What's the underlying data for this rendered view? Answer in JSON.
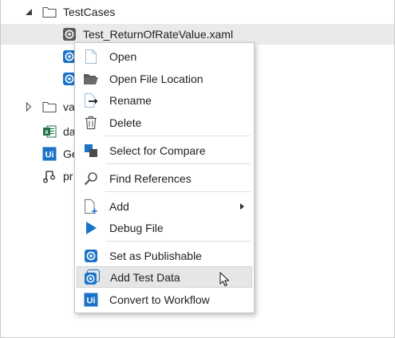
{
  "tree": {
    "rows": [
      {
        "label": "TestCases",
        "expander": "expanded",
        "icon": "folder-icon"
      },
      {
        "label": "Test_ReturnOfRateValue.xaml",
        "icon": "test-case-icon"
      },
      {
        "label": "",
        "icon": "test-case-icon"
      },
      {
        "label": "",
        "icon": "test-case-icon"
      },
      {
        "label": "va",
        "expander": "collapsed",
        "icon": "folder-icon"
      },
      {
        "label": "da",
        "icon": "excel-icon"
      },
      {
        "label": "Ge",
        "icon": "uipath-icon"
      },
      {
        "label": "pr",
        "icon": "project-icon"
      }
    ]
  },
  "context_menu": {
    "items": [
      {
        "label": "Open",
        "icon": "file-icon"
      },
      {
        "label": "Open File Location",
        "icon": "folder-open-icon"
      },
      {
        "label": "Rename",
        "icon": "rename-icon"
      },
      {
        "label": "Delete",
        "icon": "trash-icon"
      },
      {
        "label": "Select for Compare",
        "icon": "compare-icon"
      },
      {
        "label": "Find References",
        "icon": "search-icon"
      },
      {
        "label": "Add",
        "icon": "add-file-icon",
        "submenu": true
      },
      {
        "label": "Debug File",
        "icon": "play-icon"
      },
      {
        "label": "Set as Publishable",
        "icon": "publishable-icon"
      },
      {
        "label": "Add Test Data",
        "icon": "test-data-icon",
        "hovered": true
      },
      {
        "label": "Convert to Workflow",
        "icon": "uipath-icon"
      }
    ]
  },
  "colors": {
    "accent_blue": "#1a73c9",
    "selection": "#eaeaea",
    "hover": "#e6e6e6",
    "excel_green": "#1e7145"
  }
}
